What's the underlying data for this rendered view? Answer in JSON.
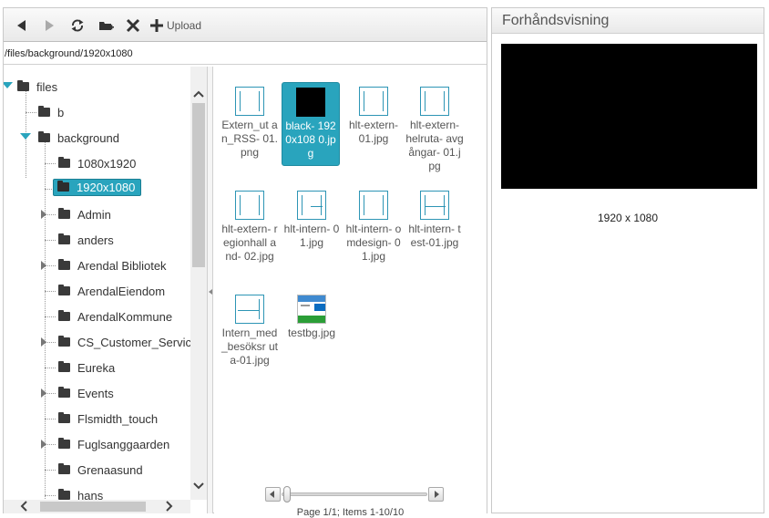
{
  "toolbar": {
    "upload_label": "Upload",
    "icons": [
      "back-icon",
      "forward-icon",
      "refresh-icon",
      "new-folder-icon",
      "delete-icon",
      "plus-icon"
    ]
  },
  "path": "/files/background/1920x1080",
  "tree": {
    "root": "files",
    "items": [
      {
        "label": "b"
      },
      {
        "label": "background"
      },
      {
        "label": "1080x1920"
      },
      {
        "label": "1920x1080"
      },
      {
        "label": "Admin"
      },
      {
        "label": "anders"
      },
      {
        "label": "Arendal Bibliotek"
      },
      {
        "label": "ArendalEiendom"
      },
      {
        "label": "ArendalKommune"
      },
      {
        "label": "CS_Customer_Servic"
      },
      {
        "label": "Eureka"
      },
      {
        "label": "Events"
      },
      {
        "label": "Flsmidth_touch"
      },
      {
        "label": "Fuglsanggaarden"
      },
      {
        "label": "Grenaasund"
      },
      {
        "label": "hans"
      }
    ]
  },
  "files": [
    {
      "name": "Extern_ut an_RSS- 01.png"
    },
    {
      "name": "black- 1920x108 0.jpg"
    },
    {
      "name": "hlt-extern- 01.jpg"
    },
    {
      "name": "hlt-extern- helruta- avgångar- 01.jpg"
    },
    {
      "name": "hlt-extern- regionhall and- 02.jpg"
    },
    {
      "name": "hlt-intern- 01.jpg"
    },
    {
      "name": "hlt-intern- omdesign- 01.jpg"
    },
    {
      "name": "hlt-intern- test-01.jpg"
    },
    {
      "name": "Intern_med _besöksr uta-01.jpg"
    },
    {
      "name": "testbg.jpg"
    }
  ],
  "pager": {
    "text": "Page 1/1; Items 1-10/10"
  },
  "preview": {
    "title": "Forhåndsvisning",
    "dimensions": "1920 x 1080"
  },
  "colors": {
    "selection": "#29a4bd",
    "preview_bg": "#000000"
  }
}
